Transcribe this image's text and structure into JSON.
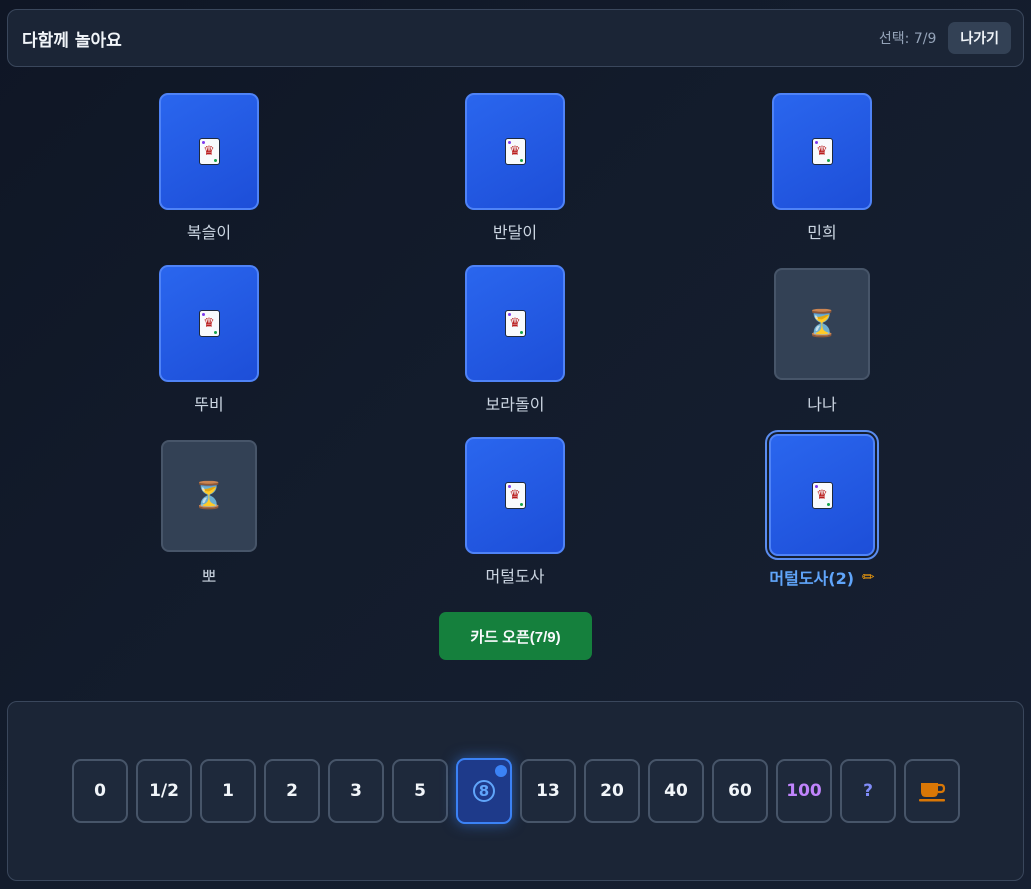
{
  "header": {
    "title": "다함께 놀아요",
    "selection_status": "선택: 7/9",
    "exit_label": "나가기"
  },
  "players": [
    {
      "name": "복슬이",
      "state": "submitted"
    },
    {
      "name": "반달이",
      "state": "submitted"
    },
    {
      "name": "민희",
      "state": "submitted"
    },
    {
      "name": "뚜비",
      "state": "submitted"
    },
    {
      "name": "보라돌이",
      "state": "submitted"
    },
    {
      "name": "나나",
      "state": "waiting"
    },
    {
      "name": "뽀",
      "state": "waiting"
    },
    {
      "name": "머털도사",
      "state": "submitted"
    },
    {
      "name": "머털도사(2)",
      "state": "submitted",
      "is_me": true
    }
  ],
  "icons": {
    "card_back": "card-back-icon",
    "waiting": "hourglass-icon",
    "edit": "pencil-icon",
    "coffee": "coffee-icon"
  },
  "open_button_label": "카드 오픈(7/9)",
  "deck": {
    "cards": [
      "0",
      "1/2",
      "1",
      "2",
      "3",
      "5",
      "8",
      "13",
      "20",
      "40",
      "60",
      "100",
      "?",
      "coffee"
    ],
    "selected": "8"
  },
  "colors": {
    "card_blue": "#2563eb",
    "open_green": "#15803d",
    "me_blue": "#60a5fa",
    "hundred_purple": "#c084fc"
  }
}
